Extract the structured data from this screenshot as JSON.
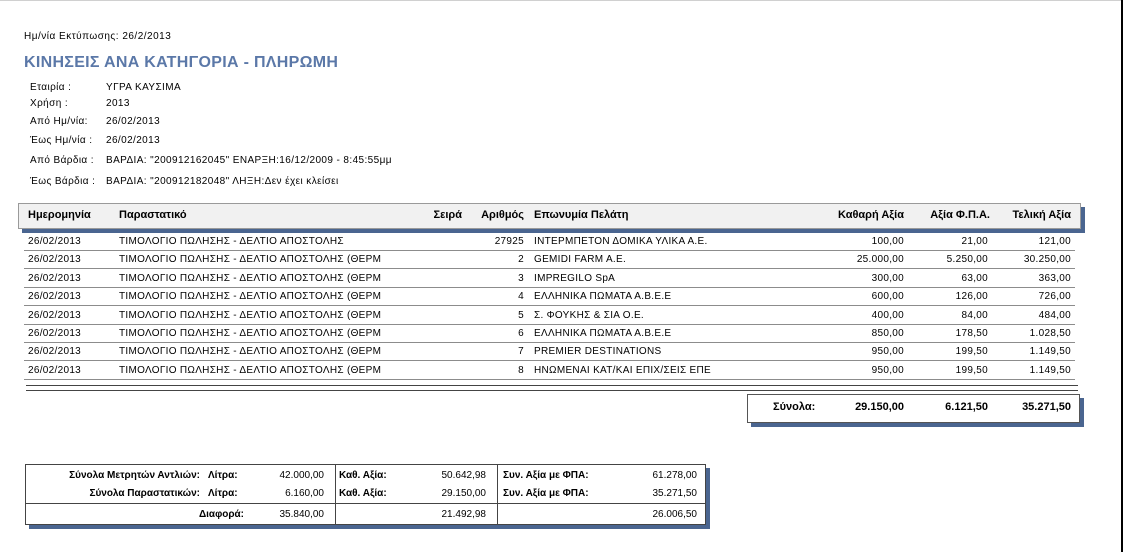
{
  "report": {
    "print_date_label": "Ημ/νία Εκτύπωσης:",
    "print_date": "26/2/2013",
    "title": "ΚΙΝΗΣΕΙΣ ΑΝΑ ΚΑΤΗΓΟΡΙΑ - ΠΛΗΡΩΜΗ",
    "filters": [
      {
        "label": "Εταιρία :",
        "value": "ΥΓΡΑ ΚΑΥΣΙΜΑ"
      },
      {
        "label": "Χρήση :",
        "value": "2013"
      },
      {
        "label": "Από Ημ/νία:",
        "value": "26/02/2013"
      },
      {
        "label": "Έως Ημ/νία :",
        "value": "26/02/2013"
      },
      {
        "label": "Από Βάρδια :",
        "value": "ΒΑΡΔΙΑ: \"200912162045\" ΕΝΑΡΞΗ:16/12/2009 -  8:45:55μμ"
      },
      {
        "label": "Έως Βάρδια :",
        "value": "ΒΑΡΔΙΑ: \"200912182048\" ΛΗΞΗ:Δεν έχει κλείσει"
      }
    ]
  },
  "table": {
    "headers": {
      "date": "Ημερομηνία",
      "doc": "Παραστατικό",
      "series": "Σειρά",
      "number": "Αριθμός",
      "customer": "Επωνυμία Πελάτη",
      "net": "Καθαρή Αξία",
      "vat": "Αξία Φ.Π.Α.",
      "total": "Τελική Αξία"
    },
    "rows": [
      {
        "date": "26/02/2013",
        "doc": "ΤΙΜΟΛΟΓΙΟ ΠΩΛΗΣΗΣ - ΔΕΛΤΙΟ ΑΠΟΣΤΟΛΗΣ",
        "series": "",
        "number": "27925",
        "customer": "ΙΝΤΕΡΜΠΕΤΟΝ ΔΟΜΙΚΑ ΥΛΙΚΑ Α.Ε.",
        "net": "100,00",
        "vat": "21,00",
        "total": "121,00"
      },
      {
        "date": "26/02/2013",
        "doc": "ΤΙΜΟΛΟΓΙΟ ΠΩΛΗΣΗΣ - ΔΕΛΤΙΟ ΑΠΟΣΤΟΛΗΣ (ΘΕΡΜ",
        "series": "",
        "number": "2",
        "customer": "GEMIDI FARM A.E.",
        "net": "25.000,00",
        "vat": "5.250,00",
        "total": "30.250,00"
      },
      {
        "date": "26/02/2013",
        "doc": "ΤΙΜΟΛΟΓΙΟ ΠΩΛΗΣΗΣ - ΔΕΛΤΙΟ ΑΠΟΣΤΟΛΗΣ (ΘΕΡΜ",
        "series": "",
        "number": "3",
        "customer": "IMPREGILO SpA",
        "net": "300,00",
        "vat": "63,00",
        "total": "363,00"
      },
      {
        "date": "26/02/2013",
        "doc": "ΤΙΜΟΛΟΓΙΟ ΠΩΛΗΣΗΣ - ΔΕΛΤΙΟ ΑΠΟΣΤΟΛΗΣ (ΘΕΡΜ",
        "series": "",
        "number": "4",
        "customer": "ΕΛΛΗΝΙΚΑ ΠΩΜΑΤΑ Α.Β.Ε.Ε",
        "net": "600,00",
        "vat": "126,00",
        "total": "726,00"
      },
      {
        "date": "26/02/2013",
        "doc": "ΤΙΜΟΛΟΓΙΟ ΠΩΛΗΣΗΣ - ΔΕΛΤΙΟ ΑΠΟΣΤΟΛΗΣ (ΘΕΡΜ",
        "series": "",
        "number": "5",
        "customer": "Σ. ΦΟΥΚΗΣ & ΣΙΑ Ο.Ε.",
        "net": "400,00",
        "vat": "84,00",
        "total": "484,00"
      },
      {
        "date": "26/02/2013",
        "doc": "ΤΙΜΟΛΟΓΙΟ ΠΩΛΗΣΗΣ - ΔΕΛΤΙΟ ΑΠΟΣΤΟΛΗΣ (ΘΕΡΜ",
        "series": "",
        "number": "6",
        "customer": "ΕΛΛΗΝΙΚΑ ΠΩΜΑΤΑ Α.Β.Ε.Ε",
        "net": "850,00",
        "vat": "178,50",
        "total": "1.028,50"
      },
      {
        "date": "26/02/2013",
        "doc": "ΤΙΜΟΛΟΓΙΟ ΠΩΛΗΣΗΣ - ΔΕΛΤΙΟ ΑΠΟΣΤΟΛΗΣ (ΘΕΡΜ",
        "series": "",
        "number": "7",
        "customer": "PREMIER DESTINATIONS",
        "net": "950,00",
        "vat": "199,50",
        "total": "1.149,50"
      },
      {
        "date": "26/02/2013",
        "doc": "ΤΙΜΟΛΟΓΙΟ ΠΩΛΗΣΗΣ - ΔΕΛΤΙΟ ΑΠΟΣΤΟΛΗΣ (ΘΕΡΜ",
        "series": "",
        "number": "8",
        "customer": "ΗΝΩΜΕΝΑΙ ΚΑΤ/ΚΑΙ ΕΠΙΧ/ΣΕΙΣ ΕΠΕ",
        "net": "950,00",
        "vat": "199,50",
        "total": "1.149,50"
      }
    ],
    "totals": {
      "label": "Σύνολα:",
      "net": "29.150,00",
      "vat": "6.121,50",
      "total": "35.271,50"
    }
  },
  "summary": {
    "row1": {
      "label": "Σύνολα Μετρητών Αντλιών:",
      "liters_label": "Λίτρα:",
      "liters": "42.000,00",
      "net_label": "Καθ. Αξία:",
      "net": "50.642,98",
      "gross_label": "Συν. Αξία με ΦΠΑ:",
      "gross": "61.278,00"
    },
    "row2": {
      "label": "Σύνολα Παραστατικών:",
      "liters_label": "Λίτρα:",
      "liters": "6.160,00",
      "net_label": "Καθ. Αξία:",
      "net": "29.150,00",
      "gross_label": "Συν. Αξία με ΦΠΑ:",
      "gross": "35.271,50"
    },
    "diff": {
      "label": "Διαφορά:",
      "liters": "35.840,00",
      "net": "21.492,98",
      "gross": "26.006,50"
    }
  }
}
